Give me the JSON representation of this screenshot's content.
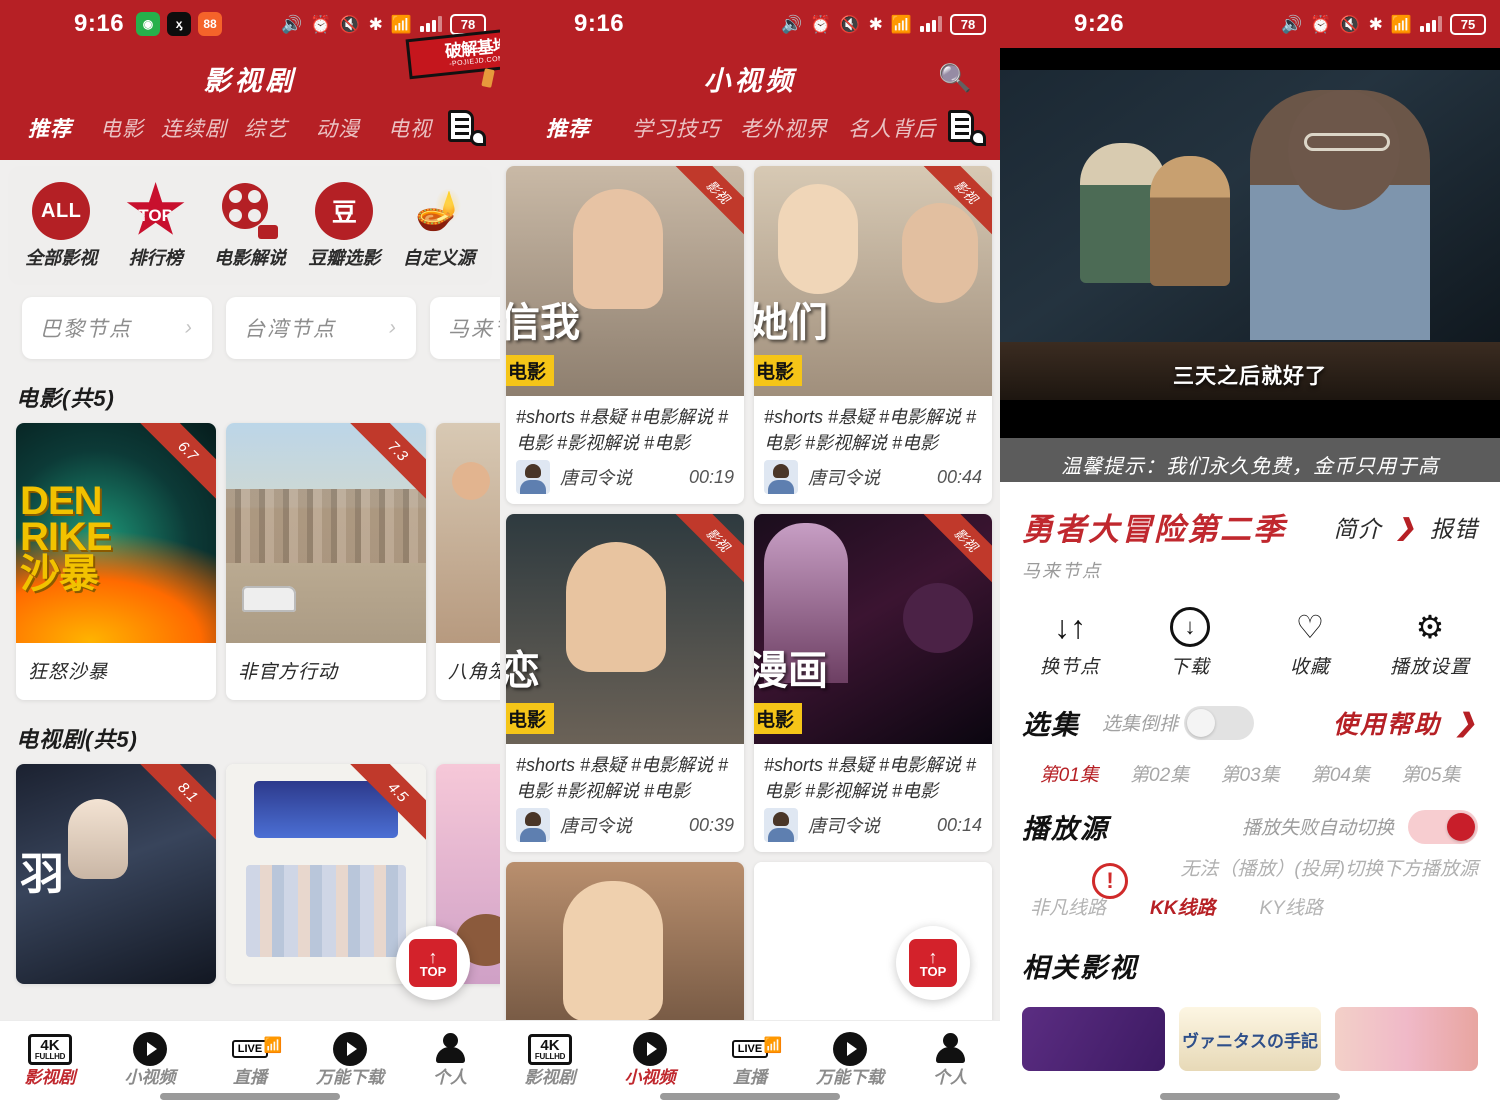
{
  "watermark": {
    "text": "破解基地",
    "url": "-POJIEJD.COM-"
  },
  "panel1": {
    "status": {
      "time": "9:16",
      "battery": "78",
      "icons": [
        "vibrate-icon",
        "alarm-icon",
        "mute-icon",
        "bluetooth-icon",
        "wifi-icon",
        "signal-icon"
      ],
      "apps": [
        "green-app-icon",
        "black-app-icon",
        "orange-app-icon"
      ]
    },
    "header": {
      "title": "影视剧"
    },
    "tabs": [
      {
        "label": "推荐",
        "active": true
      },
      {
        "label": "电影",
        "active": false
      },
      {
        "label": "连续剧",
        "active": false
      },
      {
        "label": "综艺",
        "active": false
      },
      {
        "label": "动漫",
        "active": false
      },
      {
        "label": "电视",
        "active": false
      }
    ],
    "quick_actions": [
      {
        "icon": "all-circle-icon",
        "icon_text": "ALL",
        "label": "全部影视"
      },
      {
        "icon": "top-star-icon",
        "icon_text": "TOP",
        "label": "排行榜"
      },
      {
        "icon": "film-reel-icon",
        "icon_text": "",
        "label": "电影解说"
      },
      {
        "icon": "douban-icon",
        "icon_text": "豆",
        "label": "豆瓣选影"
      },
      {
        "icon": "magic-lamp-icon",
        "icon_text": "",
        "label": "自定义源"
      }
    ],
    "nodes": [
      {
        "label": "巴黎节点"
      },
      {
        "label": "台湾节点"
      },
      {
        "label": "马来节点"
      }
    ],
    "sections": [
      {
        "title": "电影(共5)",
        "items": [
          {
            "name": "狂怒沙暴",
            "rating": "6.7",
            "art": "art1",
            "overlay": "DEN RIKE 沙暴"
          },
          {
            "name": "非官方行动",
            "rating": "7.3",
            "art": "art2",
            "overlay": ""
          },
          {
            "name": "八角笼",
            "rating": "",
            "art": "art3",
            "overlay": ""
          }
        ]
      },
      {
        "title": "电视剧(共5)",
        "items": [
          {
            "name": "",
            "rating": "8.1",
            "art": "art4",
            "overlay": "羽"
          },
          {
            "name": "",
            "rating": "4.5",
            "art": "art5",
            "overlay": ""
          },
          {
            "name": "",
            "rating": "",
            "art": "art6",
            "overlay": ""
          }
        ]
      }
    ],
    "top_button": {
      "label": "TOP",
      "arrow": "↑"
    },
    "bottom_nav": [
      {
        "label": "影视剧",
        "icon": "4k-fullhd-icon",
        "active": true
      },
      {
        "label": "小视频",
        "icon": "play-circle-icon",
        "active": false
      },
      {
        "label": "直播",
        "icon": "live-icon",
        "active": false
      },
      {
        "label": "万能下载",
        "icon": "play-circle-icon",
        "active": false
      },
      {
        "label": "个人",
        "icon": "user-icon",
        "active": false
      }
    ]
  },
  "panel2": {
    "status": {
      "time": "9:16",
      "battery": "78"
    },
    "header": {
      "title": "小视频",
      "search_icon": "search-icon"
    },
    "tabs": [
      {
        "label": "推荐",
        "active": true
      },
      {
        "label": "学习技巧",
        "active": false
      },
      {
        "label": "老外视界",
        "active": false
      },
      {
        "label": "名人背后",
        "active": false
      }
    ],
    "videos": [
      {
        "ribbon": "影视",
        "overlay_title": "信我",
        "badge": "电影",
        "tags": "#shorts #悬疑 #电影解说 #电影 #影视解说 #电影",
        "author": "唐司令说",
        "duration": "00:19",
        "art": "vt1"
      },
      {
        "ribbon": "影视",
        "overlay_title": "她们",
        "badge": "电影",
        "tags": "#shorts #悬疑 #电影解说 #电影 #影视解说 #电影",
        "author": "唐司令说",
        "duration": "00:44",
        "art": "vt2"
      },
      {
        "ribbon": "影视",
        "overlay_title": "恋",
        "badge": "电影",
        "tags": "#shorts #悬疑 #电影解说 #电影 #影视解说 #电影",
        "author": "唐司令说",
        "duration": "00:39",
        "art": "vt3"
      },
      {
        "ribbon": "影视",
        "overlay_title": "漫画",
        "badge": "电影",
        "tags": "#shorts #悬疑 #电影解说 #电影 #影视解说 #电影",
        "author": "唐司令说",
        "duration": "00:14",
        "art": "vt4"
      },
      {
        "ribbon": "影视",
        "overlay_title": "",
        "badge": "",
        "tags": "",
        "author": "",
        "duration": "",
        "art": "vt5"
      }
    ],
    "top_button": {
      "label": "TOP",
      "arrow": "↑"
    },
    "bottom_nav": [
      {
        "label": "影视剧",
        "icon": "4k-fullhd-icon",
        "active": false
      },
      {
        "label": "小视频",
        "icon": "play-circle-icon",
        "active": true
      },
      {
        "label": "直播",
        "icon": "live-icon",
        "active": false
      },
      {
        "label": "万能下载",
        "icon": "play-circle-icon",
        "active": false
      },
      {
        "label": "个人",
        "icon": "user-icon",
        "active": false
      }
    ]
  },
  "panel3": {
    "status": {
      "time": "9:26",
      "battery": "75"
    },
    "player": {
      "subtitle": "三天之后就好了"
    },
    "notice": "温馨提示：我们永久免费，金币只用于高",
    "title": "勇者大冒险第二季",
    "node": "马来节点",
    "intro_label": "简介",
    "report_label": "报错",
    "actions": [
      {
        "icon": "switch-node-icon",
        "glyph": "↓↑",
        "label": "换节点"
      },
      {
        "icon": "download-icon",
        "glyph": "↓",
        "label": "下载"
      },
      {
        "icon": "heart-icon",
        "glyph": "♡",
        "label": "收藏"
      },
      {
        "icon": "gear-icon",
        "glyph": "⚙",
        "label": "播放设置"
      }
    ],
    "episodes_section": {
      "title": "选集",
      "reverse_label": "选集倒排",
      "reverse_on": false,
      "help_label": "使用帮助",
      "episodes": [
        {
          "label": "第01集",
          "active": true
        },
        {
          "label": "第02集",
          "active": false
        },
        {
          "label": "第03集",
          "active": false
        },
        {
          "label": "第04集",
          "active": false
        },
        {
          "label": "第05集",
          "active": false
        }
      ]
    },
    "source_section": {
      "title": "播放源",
      "auto_switch_label": "播放失败自动切换",
      "auto_switch_on": true,
      "hint": "无法（播放）(投屏)切换下方播放源",
      "sources": [
        {
          "label": "非凡线路",
          "active": false,
          "warning": true
        },
        {
          "label": "KK线路",
          "active": true,
          "warning": false
        },
        {
          "label": "KY线路",
          "active": false,
          "warning": false
        }
      ]
    },
    "related": {
      "title": "相关影视",
      "items": [
        {
          "caption": "",
          "art": "rel1"
        },
        {
          "caption": "ヴァニタスの手記",
          "art": "rel2"
        },
        {
          "caption": "",
          "art": "rel3"
        }
      ]
    }
  },
  "colors": {
    "brand": "#b62025",
    "accent": "#c0282e",
    "badge_yellow": "#f5c518"
  }
}
